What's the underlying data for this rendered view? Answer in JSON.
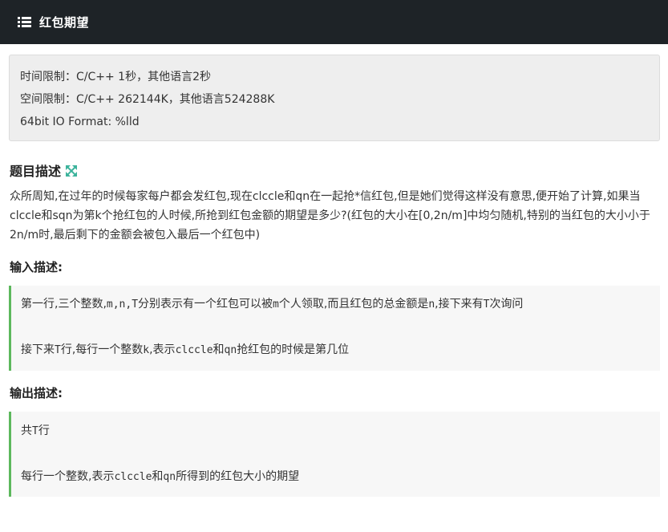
{
  "header": {
    "icon": "list-icon",
    "title": "红包期望"
  },
  "limits": {
    "time": "时间限制：C/C++ 1秒，其他语言2秒",
    "space": "空间限制：C/C++ 262144K，其他语言524288K",
    "format": "64bit IO Format: %lld"
  },
  "description": {
    "title": "题目描述",
    "expand_icon": "expand-icon",
    "text": "众所周知,在过年的时候每家每户都会发红包,现在clccle和qn在一起抢*信红包,但是她们觉得这样没有意思,便开始了计算,如果当clccle和sqn为第k个抢红包的人时候,所抢到红包金额的期望是多少?(红包的大小在[0,2n/m]中均匀随机,特别的当红包的大小小于2n/m时,最后剩下的金额会被包入最后一个红包中)"
  },
  "input": {
    "title": "输入描述:",
    "line1": {
      "a": "第一行,三个整数,",
      "b": "m,n,T",
      "c": "分别表示有一个红包可以被",
      "d": "m",
      "e": "个人领取,而且红包的总金额是",
      "f": "n",
      "g": ",接下来有",
      "h": "T",
      "i": "次询问"
    },
    "line2": {
      "a": "接下来",
      "b": "T",
      "c": "行,每行一个整数",
      "d": "k",
      "e": ",表示",
      "f": "clccle",
      "g": "和",
      "h": "qn",
      "i": "抢红包的时候是第几位"
    }
  },
  "output": {
    "title": "输出描述:",
    "line1": {
      "a": "共",
      "b": "T",
      "c": "行"
    },
    "line2": {
      "a": "每行一个整数,表示",
      "b": "clccle",
      "c": "和",
      "d": "qn",
      "e": "所得到的红包大小的期望"
    }
  },
  "colors": {
    "header_bg": "#1e2327",
    "accent_green": "#5cb85c",
    "expand_icon": "#3cb39c"
  }
}
